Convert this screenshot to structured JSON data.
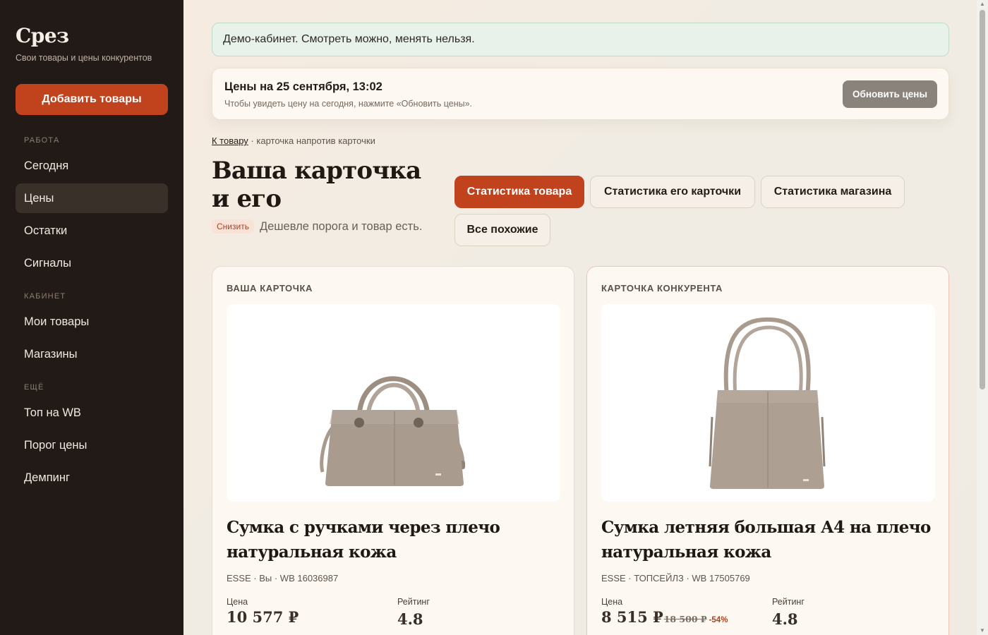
{
  "sidebar": {
    "brand": "Срез",
    "tagline": "Свои товары и цены конкурентов",
    "add_button": "Добавить товары",
    "sections": [
      {
        "label": "РАБОТА",
        "items": [
          "Сегодня",
          "Цены",
          "Остатки",
          "Сигналы"
        ]
      },
      {
        "label": "КАБИНЕТ",
        "items": [
          "Мои товары",
          "Магазины"
        ]
      },
      {
        "label": "ЕЩЁ",
        "items": [
          "Топ на WB",
          "Порог цены",
          "Демпинг"
        ]
      }
    ],
    "active_item": "Цены"
  },
  "banner": {
    "text": "Демо-кабинет. Смотреть можно, менять нельзя."
  },
  "prices_panel": {
    "title": "Цены на 25 сентября, 13:02",
    "subtitle": "Чтобы увидеть цену на сегодня, нажмите «Обновить цены».",
    "refresh_button": "Обновить цены"
  },
  "breadcrumb": {
    "link": "К товару",
    "separator": " · ",
    "current": "карточка напротив карточки"
  },
  "page": {
    "title": "Ваша карточка и его",
    "badge": "Снизить",
    "status": "Дешевле порога и товар есть."
  },
  "tabs": [
    "Статистика товара",
    "Статистика его карточки",
    "Статистика магазина",
    "Все похожие"
  ],
  "active_tab": "Статистика товара",
  "cards": [
    {
      "label": "ВАША КАРТОЧКА",
      "image": "tote-bag-with-shoulder-strap",
      "title": "Сумка с ручками через плечо натуральная кожа",
      "meta": "ESSE · Вы · WB 16036987",
      "price_label": "Цена",
      "price": "10 577 ₽",
      "old_price": "",
      "discount": "",
      "rating_label": "Рейтинг",
      "rating": "4.8"
    },
    {
      "label": "КАРТОЧКА КОНКУРЕНТА",
      "image": "tall-shoulder-tote-bag",
      "title": "Сумка летняя большая А4 на плечо натуральная кожа",
      "meta": "ESSE · ТОПСЕЙЛЗ · WB 17505769",
      "price_label": "Цена",
      "price": "8 515 ₽",
      "old_price": "18 500 ₽",
      "discount": "-54%",
      "rating_label": "Рейтинг",
      "rating": "4.8"
    }
  ],
  "colors": {
    "accent": "#c0431e",
    "sidebar_bg": "#221a16",
    "banner_bg": "#e9f2ea",
    "bag": "#a89a8d"
  }
}
